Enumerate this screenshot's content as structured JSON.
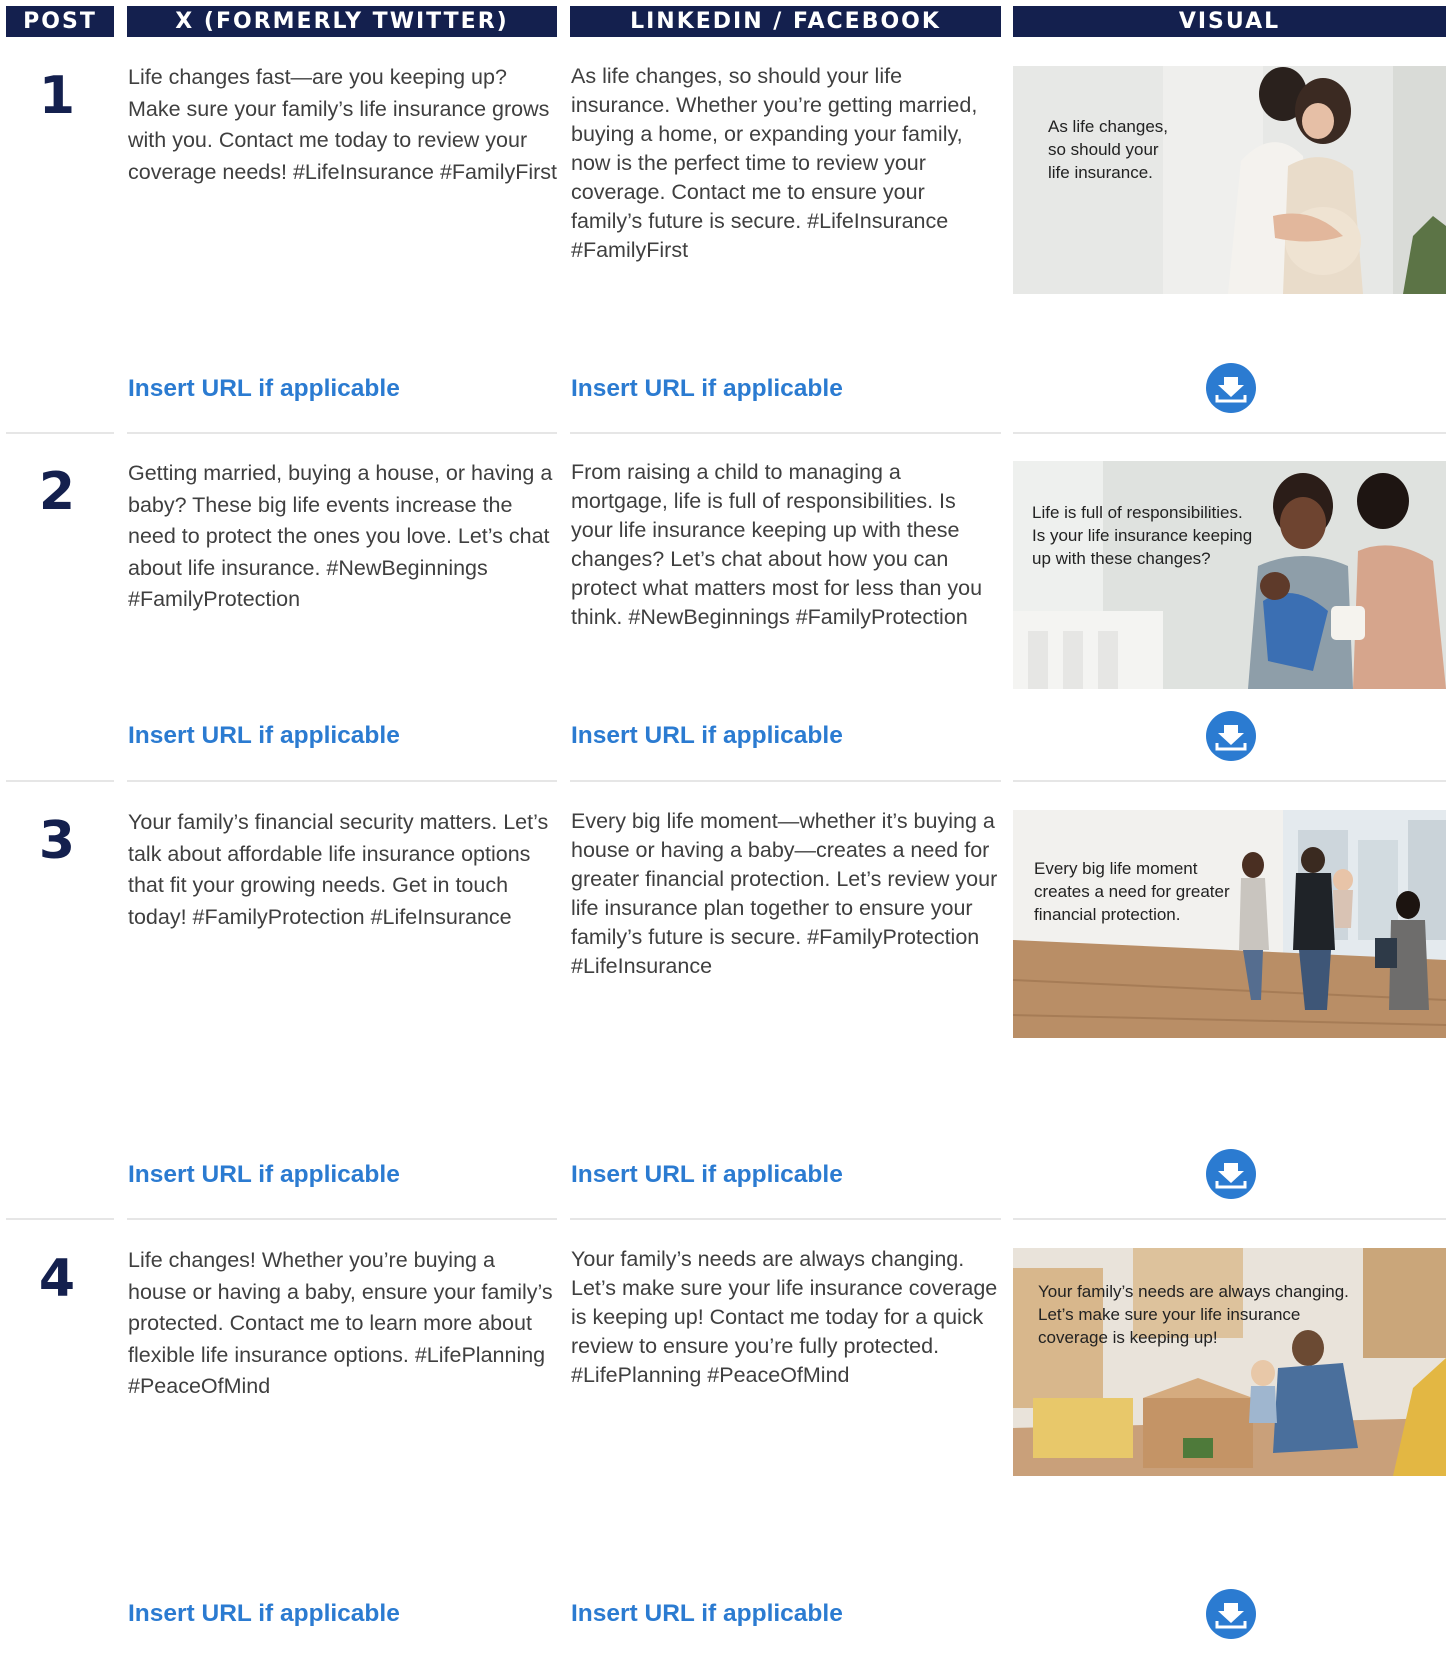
{
  "headers": {
    "post": "POST",
    "x": "X (FORMERLY TWITTER)",
    "linkedin": "LINKEDIN / FACEBOOK",
    "visual": "VISUAL"
  },
  "colors": {
    "header_bg": "#14204e",
    "post_number": "#14204e",
    "link": "#2b7bd1",
    "download_button": "#2b7bd1"
  },
  "posts": [
    {
      "number": "1",
      "x_text": "Life changes fast—are you keeping up? Make sure your family’s life insurance grows with you. Contact me today to review your coverage needs! #LifeInsurance #FamilyFirst",
      "li_text": "As life changes, so should your life insurance. Whether you’re getting married, buying a home, or expanding your family, now is the perfect time to review your coverage. Contact me to ensure your family’s future is secure. #LifeInsurance #FamilyFirst",
      "x_url": "Insert URL if applicable",
      "li_url": "Insert URL if applicable",
      "visual_caption": "As life changes,\nso should your\nlife insurance.",
      "download_icon": "download-icon"
    },
    {
      "number": "2",
      "x_text": "Getting married, buying a house, or having a baby? These big life events increase the need to protect the ones you love. Let’s chat about life insurance. #NewBeginnings #FamilyProtection",
      "li_text": "From raising a child to managing a mortgage, life is full of responsibilities. Is your life insurance keeping up with these changes? Let’s chat about how you can protect what matters most for less than you think. #NewBeginnings #FamilyProtection",
      "x_url": "Insert URL if applicable",
      "li_url": "Insert URL if applicable",
      "visual_caption": "Life is full of responsibilities.\nIs your life insurance keeping\nup with these changes?",
      "download_icon": "download-icon"
    },
    {
      "number": "3",
      "x_text": "Your family’s financial security matters. Let’s talk about affordable life insurance options that fit your growing needs. Get in touch today! #FamilyProtection #LifeInsurance",
      "li_text": "Every big life moment—whether it’s buying a house or having a baby—creates a need for greater financial protection. Let’s review your life insurance plan together to ensure your family’s future is secure. #FamilyProtection #LifeInsurance",
      "x_url": "Insert URL if applicable",
      "li_url": "Insert URL if applicable",
      "visual_caption": "Every big life moment\ncreates a need for greater\nfinancial protection.",
      "download_icon": "download-icon"
    },
    {
      "number": "4",
      "x_text": "Life changes! Whether you’re buying a house or having a baby, ensure your family’s protected. Contact me to learn more about flexible life insurance options. #LifePlanning #PeaceOfMind",
      "li_text": "Your family’s needs are always changing. Let’s make sure your life insurance coverage is keeping up! Contact me today for a quick review to ensure you’re fully protected. #LifePlanning #PeaceOfMind",
      "x_url": "Insert URL if applicable",
      "li_url": "Insert URL if applicable",
      "visual_caption": "Your family’s needs are always changing.\nLet’s make sure your life insurance\ncoverage is keeping up!",
      "download_icon": "download-icon"
    }
  ]
}
